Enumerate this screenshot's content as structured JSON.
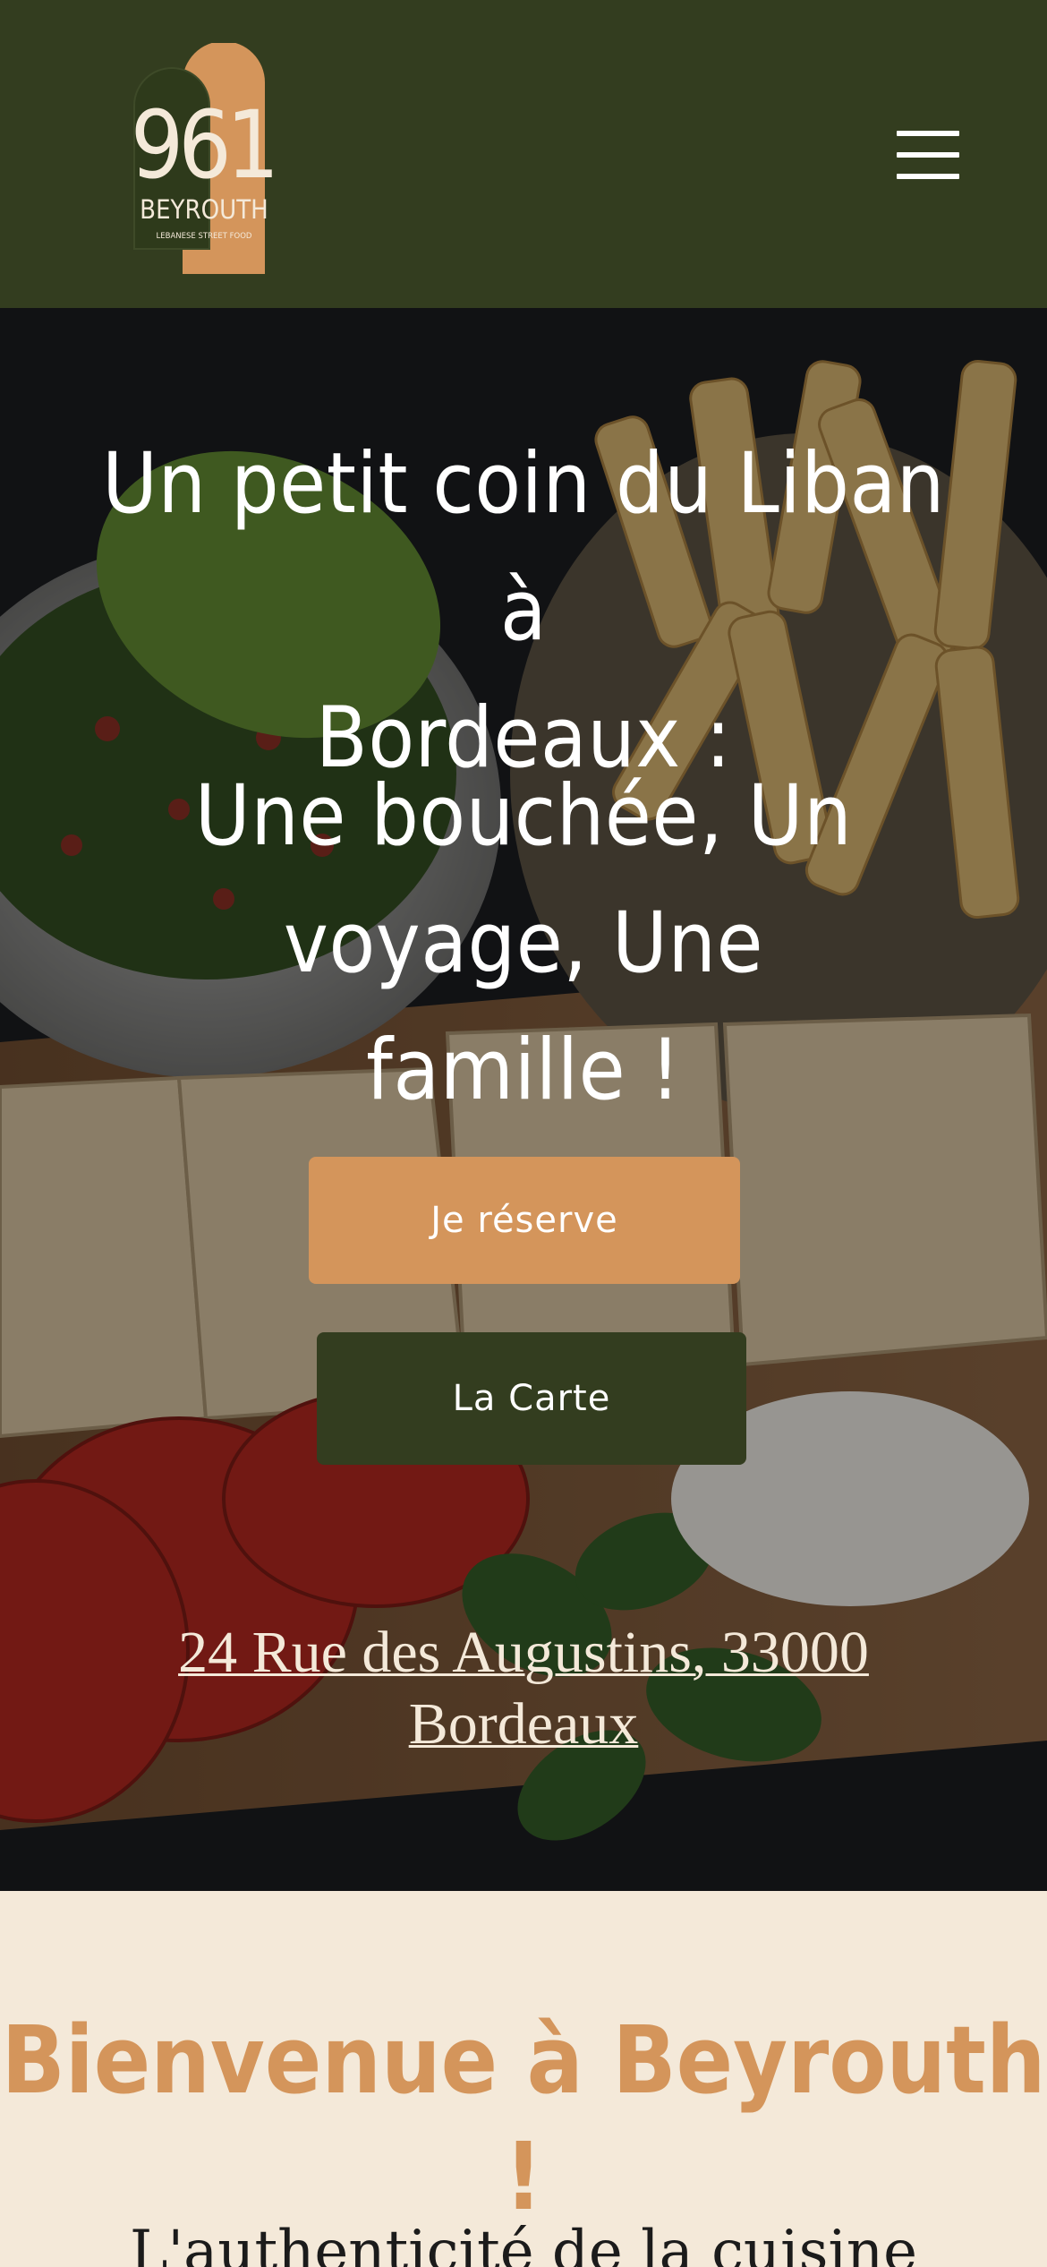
{
  "header": {
    "logo_number": "961",
    "logo_name": "BEYROUTH",
    "logo_tagline": "LEBANESE STREET FOOD",
    "menu_icon": "hamburger-menu-icon"
  },
  "hero": {
    "headline_line1": "Un petit coin du Liban à",
    "headline_line2": "Bordeaux :",
    "subline_line1": "Une bouchée, Un voyage, Une",
    "subline_line2": "famille !",
    "reserve_button": "Je réserve",
    "menu_button": "La Carte",
    "address_line1": "24 Rue des Augustins, 33000",
    "address_line2": "Bordeaux"
  },
  "welcome": {
    "title": "Bienvenue à Beyrouth !",
    "intro_partial": "L'authenticité de la cuisine"
  },
  "colors": {
    "header_bg": "#333d1f",
    "accent": "#d4955b",
    "cream": "#f4e9d9"
  }
}
